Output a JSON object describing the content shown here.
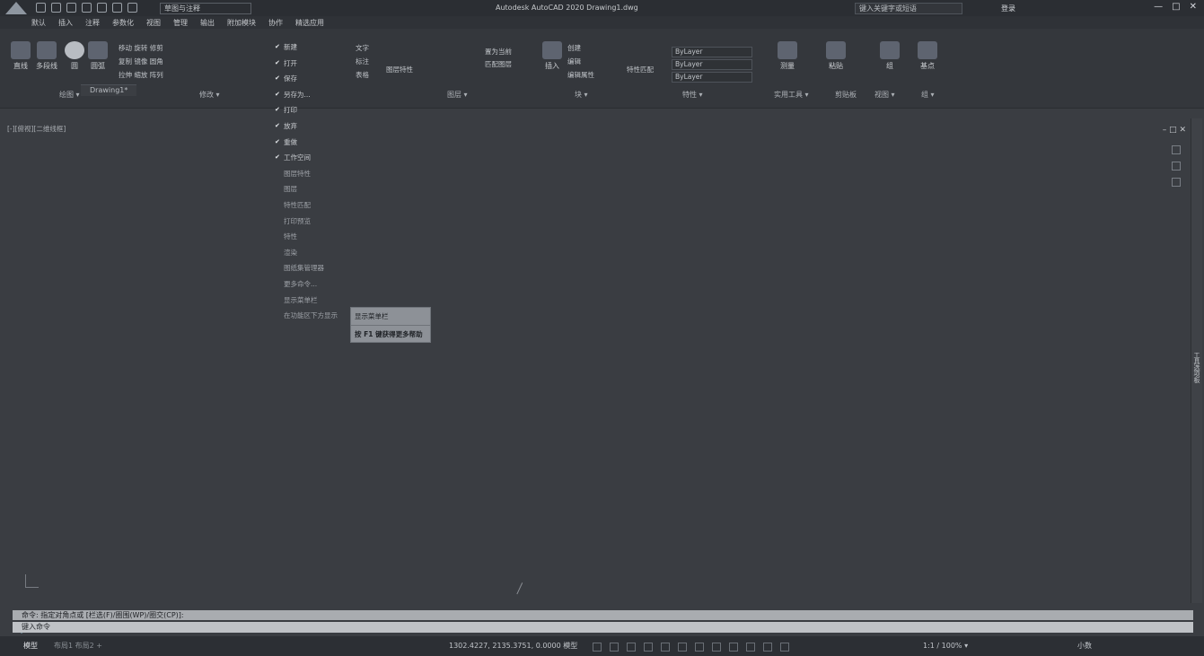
{
  "window": {
    "title": "Autodesk AutoCAD 2020   Drawing1.dwg",
    "workspace": "草图与注释",
    "search_placeholder": "键入关键字或短语",
    "user": "登录",
    "controls": [
      "—",
      "□",
      "✕"
    ]
  },
  "menubar": {
    "items": [
      "默认",
      "插入",
      "注释",
      "参数化",
      "视图",
      "管理",
      "输出",
      "附加模块",
      "协作",
      "精选应用"
    ]
  },
  "ribbon": {
    "buttons": [
      {
        "label": "直线"
      },
      {
        "label": "多段线"
      },
      {
        "label": "圆"
      },
      {
        "label": "圆弧"
      }
    ],
    "modify_rows": [
      "移动  旋转  修剪",
      "复制  镜像  圆角",
      "拉伸  缩放  阵列"
    ],
    "annotation_rows": [
      "文字",
      "标注",
      "表格"
    ],
    "layer_rows": [
      "图层特性",
      "置为当前",
      "匹配图层"
    ],
    "block_labels": [
      "插入",
      "创建",
      "编辑",
      "编辑属性"
    ],
    "properties": {
      "match_label": "特性匹配",
      "layer1": "ByLayer",
      "layer2": "ByLayer",
      "layer3": "ByLayer"
    },
    "right_labels": [
      "测量",
      "粘贴",
      "组",
      "基点"
    ],
    "panels": [
      "绘图 ▾",
      "修改 ▾",
      "图层 ▾",
      "块 ▾",
      "特性 ▾",
      "实用工具 ▾",
      "剪贴板",
      "视图 ▾",
      "组 ▾"
    ]
  },
  "file_tab": "Drawing1*",
  "viewport_label": "[-][俯视][二维线框]",
  "viewport_controls": "– □ ✕",
  "context_menu": {
    "items": [
      {
        "label": "新建",
        "checked": true
      },
      {
        "label": "打开",
        "checked": true
      },
      {
        "label": "保存",
        "checked": true
      },
      {
        "label": "另存为...",
        "checked": true
      },
      {
        "label": "打印",
        "checked": true
      },
      {
        "label": "放弃",
        "checked": true
      },
      {
        "label": "重做",
        "checked": true
      },
      {
        "label": "工作空间",
        "checked": true
      },
      {
        "label": "图层特性",
        "checked": false
      },
      {
        "label": "图层",
        "checked": false
      },
      {
        "label": "特性匹配",
        "checked": false
      },
      {
        "label": "打印预览",
        "checked": false
      },
      {
        "label": "特性",
        "checked": false
      },
      {
        "label": "渲染",
        "checked": false
      },
      {
        "label": "图纸集管理器",
        "checked": false
      },
      {
        "label": "更多命令...",
        "checked": false
      },
      {
        "label": "显示菜单栏",
        "checked": false
      },
      {
        "label": "在功能区下方显示",
        "checked": false
      }
    ]
  },
  "tooltip": {
    "line1": "显示菜单栏",
    "line2": "按 F1 键获得更多帮助"
  },
  "command": {
    "history": "命令: 指定对角点或 [栏选(F)/圈围(WP)/圈交(CP)]:",
    "input_placeholder": "键入命令"
  },
  "side_palette": "工具选项板",
  "status": {
    "model": "模型",
    "layouts": "布局1  布局2  +",
    "coords": "1302.4227, 2135.3751, 0.0000  模型",
    "scale": "1:1 / 100% ▾",
    "units": "小数"
  }
}
